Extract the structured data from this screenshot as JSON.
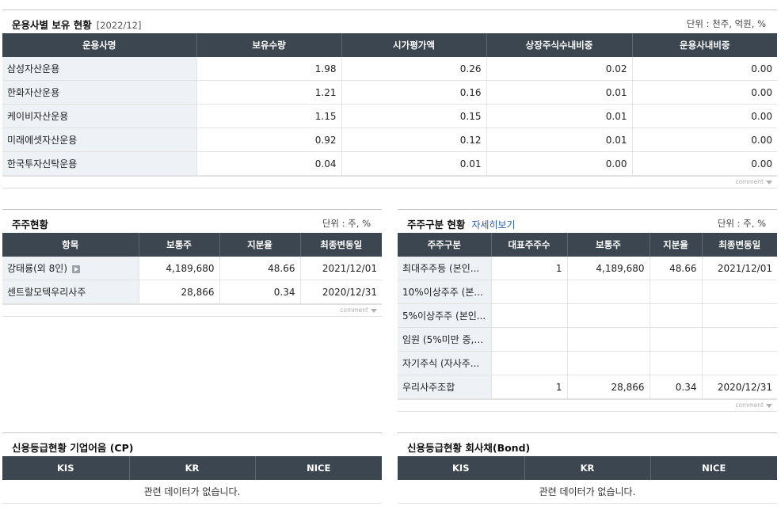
{
  "top": {
    "title": "운용사별 보유 현황",
    "period": "[2022/12]",
    "unit": "단위 : 천주, 억원, %",
    "headers": [
      "운용사명",
      "보유수량",
      "시가평가액",
      "상장주식수내비중",
      "운용사내비중"
    ],
    "rows": [
      [
        "삼성자산운용",
        "1.98",
        "0.26",
        "0.02",
        "0.00"
      ],
      [
        "한화자산운용",
        "1.21",
        "0.16",
        "0.01",
        "0.00"
      ],
      [
        "케이비자산운용",
        "1.15",
        "0.15",
        "0.01",
        "0.00"
      ],
      [
        "미래에셋자산운용",
        "0.92",
        "0.12",
        "0.01",
        "0.00"
      ],
      [
        "한국투자신탁운용",
        "0.04",
        "0.01",
        "0.00",
        "0.00"
      ]
    ],
    "comment": "comment"
  },
  "holders": {
    "title": "주주현황",
    "unit": "단위 : 주, %",
    "headers": [
      "항목",
      "보통주",
      "지분율",
      "최종변동일"
    ],
    "rows": [
      [
        "강태룡(외 8인)",
        "4,189,680",
        "48.66",
        "2021/12/01"
      ],
      [
        "센트랄모텍우리사주",
        "28,866",
        "0.34",
        "2020/12/31"
      ]
    ],
    "comment": "comment"
  },
  "classes": {
    "title": "주주구분 현황",
    "link": "자세히보기",
    "unit": "단위 : 주, %",
    "headers": [
      "주주구분",
      "대표주주수",
      "보통주",
      "지분율",
      "최종변동일"
    ],
    "rows": [
      [
        "최대주주등 (본인...",
        "1",
        "4,189,680",
        "48.66",
        "2021/12/01"
      ],
      [
        "10%이상주주 (본...",
        "",
        "",
        "",
        ""
      ],
      [
        "5%이상주주 (본인...",
        "",
        "",
        "",
        ""
      ],
      [
        "임원 (5%미만 중, ...",
        "",
        "",
        "",
        ""
      ],
      [
        "자기주식 (자사주...",
        "",
        "",
        "",
        ""
      ],
      [
        "우리사주조합",
        "1",
        "28,866",
        "0.34",
        "2020/12/31"
      ]
    ],
    "comment": "comment"
  },
  "cp": {
    "title": "신용등급현황 기업어음 (CP)",
    "headers": [
      "KIS",
      "KR",
      "NICE"
    ],
    "empty": "관련 데이터가 없습니다."
  },
  "bond": {
    "title": "신용등급현황 회사채(Bond)",
    "headers": [
      "KIS",
      "KR",
      "NICE"
    ],
    "empty": "관련 데이터가 없습니다."
  }
}
